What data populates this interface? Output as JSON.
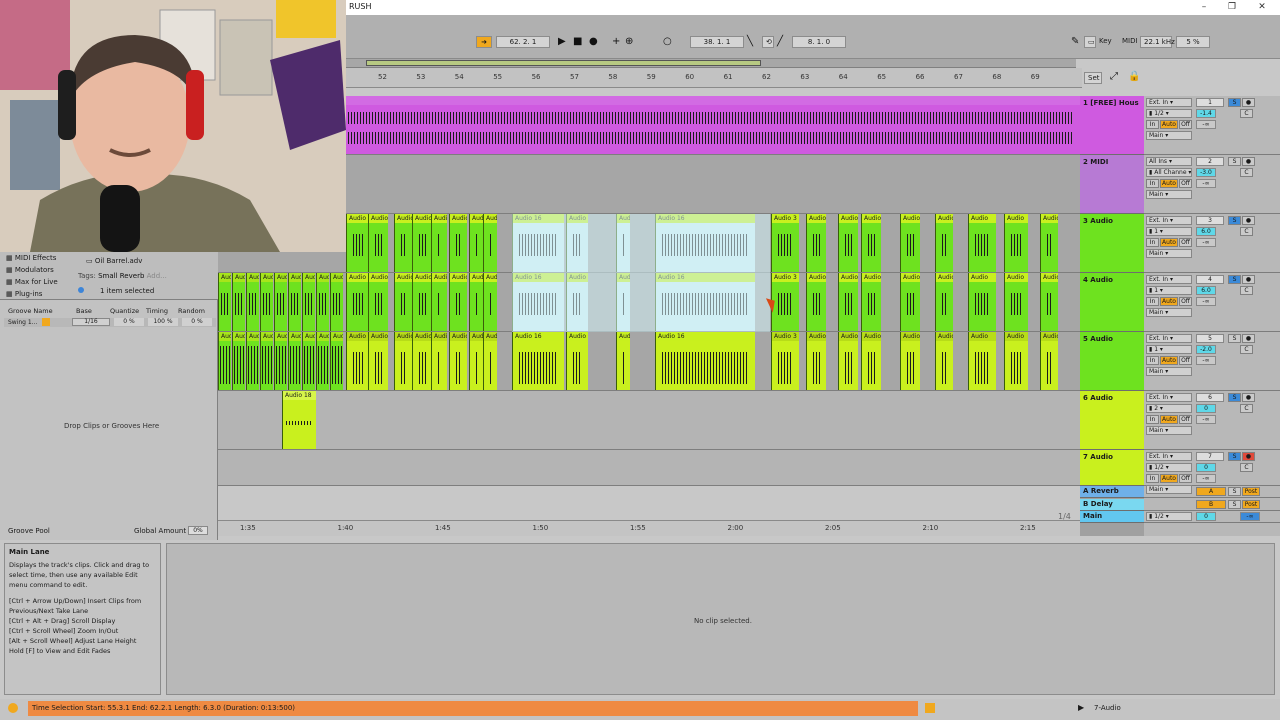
{
  "titlebar": {
    "title": "RUSH",
    "minimize": "–",
    "restore": "❐",
    "close": "✕"
  },
  "transport": {
    "arrangement_pos": "62. 2. 1",
    "loop_start": "38. 1. 1",
    "loop_length": "8. 1. 0",
    "key_label": "Key",
    "midi_label": "MIDI",
    "sample_rate": "22.1 kHz",
    "cpu": "5 %"
  },
  "ruler": {
    "bars": [
      "52",
      "53",
      "54",
      "55",
      "56",
      "57",
      "58",
      "59",
      "60",
      "61",
      "62",
      "63",
      "64",
      "65",
      "66",
      "67",
      "68",
      "69"
    ],
    "set_label": "Set"
  },
  "time_markers": [
    "1:35",
    "1:40",
    "1:45",
    "1:50",
    "1:55",
    "2:00",
    "2:05",
    "2:10",
    "2:15"
  ],
  "zoom_label": "1/4",
  "tracks": [
    {
      "name": "1 [FREE] Hous",
      "color": "#cf5ae0",
      "input": "Ext. In",
      "channel": "1/2",
      "output": "Main",
      "number": "1",
      "volume": "-1.4",
      "pan": "C",
      "clip_label": "at - RUSH"
    },
    {
      "name": "2 MIDI",
      "color": "#b77ad4",
      "input": "All Ins",
      "channel": "All Channe",
      "output": "Main",
      "number": "2",
      "volume": "-3.0",
      "pan": "C"
    },
    {
      "name": "3 Audio",
      "color": "#6ee21f",
      "input": "Ext. In",
      "channel": "1",
      "output": "Main",
      "number": "3",
      "volume": "6.0",
      "pan": "C"
    },
    {
      "name": "4 Audio",
      "color": "#6ee21f",
      "input": "Ext. In",
      "channel": "1",
      "output": "Main",
      "number": "4",
      "volume": "6.0",
      "pan": "C"
    },
    {
      "name": "5 Audio",
      "color": "#6ee21f",
      "input": "Ext. In",
      "channel": "1",
      "output": "Main",
      "number": "5",
      "volume": "-2.0",
      "pan": "C"
    },
    {
      "name": "6 Audio",
      "color": "#c9f01e",
      "input": "Ext. In",
      "channel": "2",
      "output": "Main",
      "number": "6",
      "volume": "0",
      "pan": "C"
    },
    {
      "name": "7 Audio",
      "color": "#c9f01e",
      "input": "Ext. In",
      "channel": "1/2",
      "output": "Main",
      "number": "7",
      "volume": "0",
      "pan": "C"
    }
  ],
  "returns": [
    {
      "name": "A Reverb",
      "color": "#6fb0e8",
      "send": "A"
    },
    {
      "name": "B Delay",
      "color": "#7ad8f0",
      "send": "B"
    },
    {
      "name": "Main",
      "color": "#62c7f0",
      "channel": "1/2",
      "volume": "0"
    }
  ],
  "io_labels": {
    "in": "In",
    "auto": "Auto",
    "off": "Off",
    "post": "Post",
    "solo": "S",
    "inf": "-∞"
  },
  "clip_names": {
    "a16": "Audio 16",
    "a3": "Audio 3",
    "a": "Audio",
    "au": "Aud",
    "a18": "Audio 18"
  },
  "browser": {
    "items": [
      "MIDI Effects",
      "Modulators",
      "Max for Live",
      "Plug-ins"
    ],
    "file": "Oil Barrel.adv",
    "tags_label": "Tags:",
    "tag": "Small Reverb",
    "tag_add": "Add...",
    "selection": "1 item selected"
  },
  "groove": {
    "headers": [
      "Groove Name",
      "Base",
      "Quantize",
      "Timing",
      "Random"
    ],
    "row": {
      "name": "Swing 1...",
      "base": "1/16",
      "quantize": "0 %",
      "timing": "100 %",
      "random": "0 %"
    },
    "drop_text": "Drop Clips or Grooves Here",
    "pool_label": "Groove Pool",
    "global_label": "Global Amount",
    "global_value": "0%"
  },
  "info": {
    "title": "Main Lane",
    "lines": [
      "Displays the track's clips. Click and drag to select time, then use any available Edit menu command to edit.",
      "[Ctrl + Arrow Up/Down] Insert Clips from Previous/Next Take Lane",
      "[Ctrl + Alt + Drag] Scroll Display",
      "[Ctrl + Scroll Wheel] Zoom In/Out",
      "[Alt + Scroll Wheel] Adjust Lane Height",
      "Hold [F] to View and Edit Fades"
    ]
  },
  "detail": {
    "empty_text": "No clip selected."
  },
  "status": {
    "text": "Time Selection   Start: 55.3.1   End: 62.2.1   Length: 6.3.0 (Duration: 0:13:500)",
    "track": "7-Audio"
  }
}
